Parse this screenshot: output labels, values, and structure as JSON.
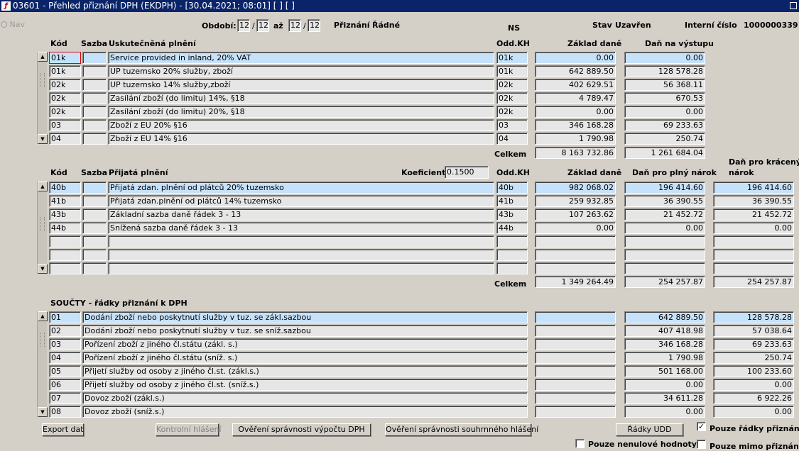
{
  "window": {
    "title": "03601 - Přehled přiznání DPH (EKDPH) - [30.04.2021; 08:01]  [ ]  [ ]"
  },
  "nav_label": "Nav",
  "header": {
    "obdobi_label": "Období:",
    "obdobi_from_month": "12",
    "obdobi_from_sep": "/",
    "obdobi_from_year": "12",
    "az_label": "až",
    "obdobi_to_month": "12",
    "obdobi_to_sep": "/",
    "obdobi_to_year": "12",
    "priznani_label": "Přiznání",
    "priznani_value": "Řádné",
    "ns_label": "NS",
    "stav_label": "Stav",
    "stav_value": "Uzavřen",
    "interni_label": "Interní číslo",
    "interni_value": "1000000339"
  },
  "section1": {
    "headers": {
      "kod": "Kód",
      "sazba": "Sazba",
      "desc": "Uskutečněná plnění",
      "oddkh": "Odd.KH",
      "zaklad": "Základ daně",
      "dan": "Daň na výstupu"
    },
    "rows": [
      {
        "kod": "01k",
        "sazba": "",
        "desc": "Service provided in inland, 20% VAT",
        "oddkh": "01k",
        "zaklad": "0.00",
        "dan": "0.00"
      },
      {
        "kod": "01k",
        "sazba": "",
        "desc": "UP tuzemsko 20%  služby, zboží",
        "oddkh": "01k",
        "zaklad": "642 889.50",
        "dan": "128 578.28"
      },
      {
        "kod": "02k",
        "sazba": "",
        "desc": "UP tuzemsko 14% služby,zboží",
        "oddkh": "02k",
        "zaklad": "402 629.51",
        "dan": "56 368.11"
      },
      {
        "kod": "02k",
        "sazba": "",
        "desc": "Zasílání zboží (do limitu) 14%, §18",
        "oddkh": "02k",
        "zaklad": "4 789.47",
        "dan": "670.53"
      },
      {
        "kod": "02k",
        "sazba": "",
        "desc": "Zasílání zboží (do limitu) 20%, §18",
        "oddkh": "02k",
        "zaklad": "0.00",
        "dan": "0.00"
      },
      {
        "kod": "03",
        "sazba": "",
        "desc": "Zboží z EU 20%  §16",
        "oddkh": "03",
        "zaklad": "346 168.28",
        "dan": "69 233.63"
      },
      {
        "kod": "04",
        "sazba": "",
        "desc": "Zboží z EU 14% §16",
        "oddkh": "04",
        "zaklad": "1 790.98",
        "dan": "250.74"
      }
    ],
    "celkem_label": "Celkem",
    "celkem_zaklad": "8 163 732.86",
    "celkem_dan": "1 261 684.04"
  },
  "section2": {
    "headers": {
      "kod": "Kód",
      "sazba": "Sazba",
      "desc": "Přijatá plnění",
      "koef_label": "Koeficient",
      "koef_value": "0.1500",
      "oddkh": "Odd.KH",
      "zaklad": "Základ daně",
      "dan_plny": "Daň pro plný nárok",
      "dan_kraceny_1": "Daň pro krácený",
      "dan_kraceny_2": "nárok"
    },
    "rows": [
      {
        "kod": "40b",
        "sazba": "",
        "desc": "Přijatá zdan. plnění od plátců 20% tuzemsko",
        "oddkh": "40b",
        "zaklad": "982 068.02",
        "dan_plny": "196 414.60",
        "dan_kraceny": "196 414.60"
      },
      {
        "kod": "41b",
        "sazba": "",
        "desc": "Přijatá zdan.plnění od plátců 14% tuzemsko",
        "oddkh": "41b",
        "zaklad": "259 932.85",
        "dan_plny": "36 390.55",
        "dan_kraceny": "36 390.55"
      },
      {
        "kod": "43b",
        "sazba": "",
        "desc": "Základní sazba daně řádek 3 - 13",
        "oddkh": "43b",
        "zaklad": "107 263.62",
        "dan_plny": "21 452.72",
        "dan_kraceny": "21 452.72"
      },
      {
        "kod": "44b",
        "sazba": "",
        "desc": "Snížená sazba daně řádek 3 - 13",
        "oddkh": "44b",
        "zaklad": "0.00",
        "dan_plny": "0.00",
        "dan_kraceny": "0.00"
      },
      {
        "kod": "",
        "sazba": "",
        "desc": "",
        "oddkh": "",
        "zaklad": "",
        "dan_plny": "",
        "dan_kraceny": ""
      },
      {
        "kod": "",
        "sazba": "",
        "desc": "",
        "oddkh": "",
        "zaklad": "",
        "dan_plny": "",
        "dan_kraceny": ""
      },
      {
        "kod": "",
        "sazba": "",
        "desc": "",
        "oddkh": "",
        "zaklad": "",
        "dan_plny": "",
        "dan_kraceny": ""
      }
    ],
    "celkem_label": "Celkem",
    "celkem_zaklad": "1 349 264.49",
    "celkem_dan_plny": "254 257.87",
    "celkem_dan_kraceny": "254 257.87"
  },
  "section3": {
    "title": "SOUČTY - řádky přiznání k DPH",
    "rows": [
      {
        "kod": "01",
        "desc": "Dodání zboží nebo poskytnutí služby v tuz. se zákl.sazbou",
        "col1": "",
        "col2": "642 889.50",
        "col3": "128 578.28"
      },
      {
        "kod": "02",
        "desc": "Dodání zboží nebo poskytnutí služby v tuz. se sníž.sazbou",
        "col1": "",
        "col2": "407 418.98",
        "col3": "57 038.64"
      },
      {
        "kod": "03",
        "desc": "Pořízení zboží z jiného čl.státu (zákl. s.)",
        "col1": "",
        "col2": "346 168.28",
        "col3": "69 233.63"
      },
      {
        "kod": "04",
        "desc": "Pořízení zboží z jiného čl.státu (sníž. s.)",
        "col1": "",
        "col2": "1 790.98",
        "col3": "250.74"
      },
      {
        "kod": "05",
        "desc": "Přijetí služby od osoby z jiného čl.st. (zákl.s.)",
        "col1": "",
        "col2": "501 168.00",
        "col3": "100 233.60"
      },
      {
        "kod": "06",
        "desc": "Přijetí služby od osoby z jiného čl.st. (sníž.s.)",
        "col1": "",
        "col2": "0.00",
        "col3": "0.00"
      },
      {
        "kod": "07",
        "desc": "Dovoz zboží (zákl.s.)",
        "col1": "",
        "col2": "34 611.28",
        "col3": "6 922.26"
      },
      {
        "kod": "08",
        "desc": "Dovoz zboží (sníž.s.)",
        "col1": "",
        "col2": "0.00",
        "col3": "0.00"
      }
    ]
  },
  "buttons": {
    "export": "Export dat",
    "kontrolni": "Kontrolní hlášení",
    "overeni_vypoctu": "Ověření správnosti výpočtu DPH",
    "overeni_souhrnneho": "Ověření správnosti souhrnného hlášení",
    "radky_udd": "Řádky UDD"
  },
  "checkboxes": {
    "pouze_radky": {
      "label": "Pouze řádky přiznání",
      "checked": true,
      "mark": "✓"
    },
    "pouze_nenulove": {
      "label": "Pouze nenulové hodnoty",
      "checked": false,
      "mark": ""
    },
    "pouze_mimo": {
      "label": "Pouze mimo přiznání",
      "checked": false,
      "mark": ""
    }
  }
}
